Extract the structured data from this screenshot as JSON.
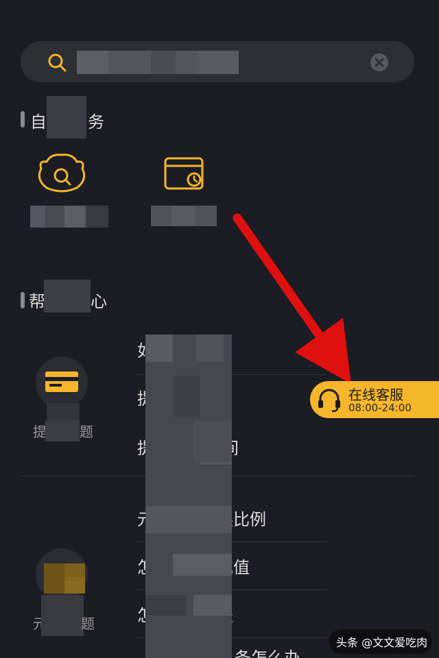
{
  "search": {
    "placeholder_obscured": true
  },
  "self_service": {
    "title_left": "自",
    "title_right": "务"
  },
  "help_center": {
    "title_left": "帮",
    "title_right": "心",
    "categories": [
      {
        "label_left": "提",
        "label_right": "题"
      },
      {
        "label_left": "元",
        "label_right": "题"
      }
    ],
    "faq_items": [
      {
        "prefix": "如",
        "suffix": ""
      },
      {
        "prefix": "提",
        "suffix": ""
      },
      {
        "prefix": "提",
        "suffix": "间"
      },
      {
        "prefix": "元",
        "suffix": "换比例"
      },
      {
        "prefix": "怎",
        "suffix": "充值"
      },
      {
        "prefix": "怎",
        "suffix": "提"
      },
      {
        "prefix": "",
        "suffix": "条怎么办"
      }
    ]
  },
  "customer_service": {
    "title": "在线客服",
    "hours": "08:00-24:00"
  },
  "watermark": {
    "text": "头条 @文文爱吃肉"
  },
  "colors": {
    "background": "#1c1c24",
    "accent": "#f5b62b",
    "annotation_arrow": "#e01010"
  },
  "icons": {
    "search": "search-icon",
    "clear": "clear-icon",
    "ingot": "ingot-search-icon",
    "calendar": "calendar-clock-icon",
    "card": "card-icon",
    "headset": "headset-icon"
  }
}
